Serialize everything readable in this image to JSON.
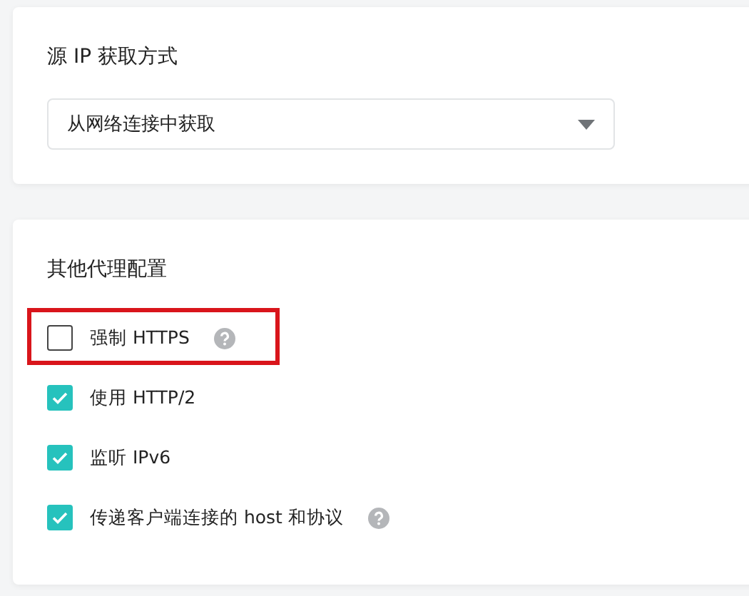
{
  "source_ip": {
    "title": "源 IP 获取方式",
    "select": {
      "value": "从网络连接中获取"
    }
  },
  "proxy": {
    "title": "其他代理配置",
    "options": [
      {
        "label": "强制 HTTPS",
        "checked": false,
        "help": true,
        "highlighted": true
      },
      {
        "label": "使用 HTTP/2",
        "checked": true,
        "help": false,
        "highlighted": false
      },
      {
        "label": "监听 IPv6",
        "checked": true,
        "help": false,
        "highlighted": false
      },
      {
        "label": "传递客户端连接的 host 和协议",
        "checked": true,
        "help": true,
        "highlighted": false
      }
    ]
  }
}
